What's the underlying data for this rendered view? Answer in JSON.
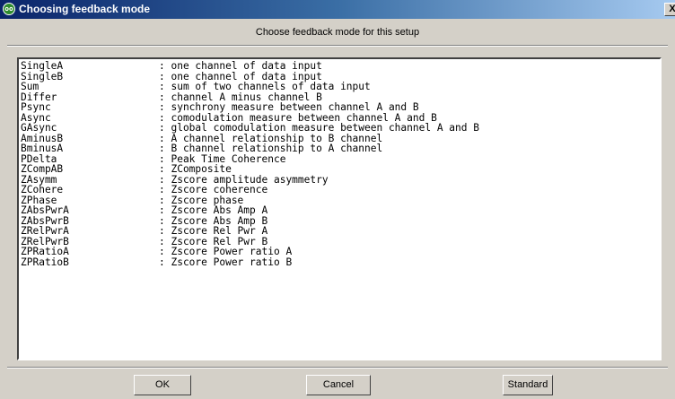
{
  "window": {
    "title": "Choosing feedback mode",
    "subtitle": "Choose feedback mode for this setup",
    "close_label": "X"
  },
  "modes": [
    {
      "name": "SingleA",
      "desc": ": one channel of data input"
    },
    {
      "name": "SingleB",
      "desc": ": one channel of data input"
    },
    {
      "name": "Sum",
      "desc": ": sum of two channels of data input"
    },
    {
      "name": "Differ",
      "desc": ": channel A minus channel B"
    },
    {
      "name": "Psync",
      "desc": ": synchrony measure between channel A and B"
    },
    {
      "name": "Async",
      "desc": ": comodulation measure between channel A and B"
    },
    {
      "name": "GAsync",
      "desc": ": global comodulation measure between channel A and B"
    },
    {
      "name": "AminusB",
      "desc": ": A channel relationship to B channel"
    },
    {
      "name": "BminusA",
      "desc": ": B channel relationship to A channel"
    },
    {
      "name": "PDelta",
      "desc": ": Peak Time Coherence"
    },
    {
      "name": "ZCompAB",
      "desc": ": ZComposite"
    },
    {
      "name": "ZAsymm",
      "desc": ": Zscore amplitude asymmetry"
    },
    {
      "name": "ZCohere",
      "desc": ": Zscore coherence"
    },
    {
      "name": "ZPhase",
      "desc": ": Zscore phase"
    },
    {
      "name": "ZAbsPwrA",
      "desc": ": Zscore Abs Amp A"
    },
    {
      "name": "ZAbsPwrB",
      "desc": ": Zscore Abs Amp B"
    },
    {
      "name": "ZRelPwrA",
      "desc": ": Zscore Rel Pwr A"
    },
    {
      "name": "ZRelPwrB",
      "desc": ": Zscore Rel Pwr B"
    },
    {
      "name": "ZPRatioA",
      "desc": ": Zscore Power ratio A"
    },
    {
      "name": "ZPRatioB",
      "desc": ": Zscore Power ratio B"
    }
  ],
  "buttons": {
    "ok": "OK",
    "cancel": "Cancel",
    "standard": "Standard"
  },
  "colors": {
    "titlebar_start": "#0a246a",
    "titlebar_end": "#a6caf0",
    "face": "#d4d0c8",
    "icon_green": "#2e8b2e"
  }
}
